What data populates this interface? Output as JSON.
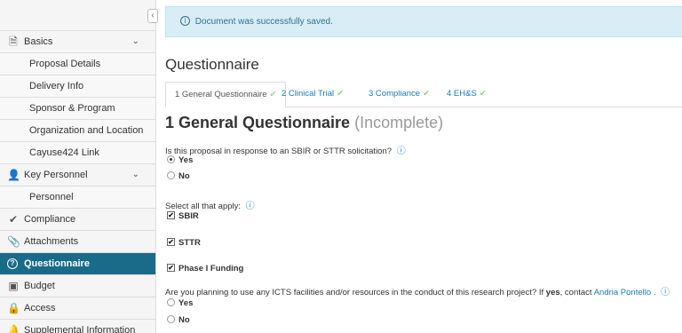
{
  "sidebar": {
    "collapse_glyph": "‹",
    "items": [
      {
        "label": "Basics",
        "icon": "document-icon",
        "glyph": "🗎",
        "chevron": "⌄"
      },
      {
        "label": "Proposal Details"
      },
      {
        "label": "Delivery Info"
      },
      {
        "label": "Sponsor & Program Information"
      },
      {
        "label": "Organization and Location"
      },
      {
        "label": "Cayuse424 Link"
      },
      {
        "label": "Key Personnel",
        "icon": "person-icon",
        "glyph": "👤",
        "chevron": "⌄"
      },
      {
        "label": "Personnel"
      },
      {
        "label": "Compliance",
        "icon": "check-icon",
        "glyph": "✔"
      },
      {
        "label": "Attachments",
        "icon": "paperclip-icon",
        "glyph": "📎"
      },
      {
        "label": "Questionnaire",
        "icon": "question-circle-icon",
        "glyph": "?"
      },
      {
        "label": "Budget",
        "icon": "money-icon",
        "glyph": "▣"
      },
      {
        "label": "Access",
        "icon": "lock-icon",
        "glyph": "🔒"
      },
      {
        "label": "Supplemental Information",
        "icon": "bell-icon",
        "glyph": "🔔"
      }
    ]
  },
  "alert": {
    "message": "Document was successfully saved.",
    "icon_glyph": "i"
  },
  "page_title": "Questionnaire",
  "tabs": [
    {
      "label": "1 General Questionnaire",
      "check": "✔"
    },
    {
      "label": "2 Clinical Trial",
      "check": "✔"
    },
    {
      "label": "3 Compliance",
      "check": "✔"
    },
    {
      "label": "4 EH&S",
      "check": "✔"
    }
  ],
  "section": {
    "title": "1 General Questionnaire",
    "status": "(Incomplete)"
  },
  "questions": {
    "q1": {
      "text": "Is this proposal in response to an SBIR or STTR solicitation?",
      "info_glyph": "ⓘ",
      "options": [
        "Yes",
        "No"
      ],
      "selected": "Yes"
    },
    "q2": {
      "text": "Select all that apply:",
      "info_glyph": "ⓘ",
      "options": [
        "SBIR",
        "STTR",
        "Phase I Funding"
      ],
      "check_glyph": "✔"
    },
    "q3": {
      "text_before": "Are you planning to use any ICTS facilities and/or resources in the conduct of this research project? If",
      "bold": "yes",
      "text_mid": ", contact",
      "link": "Andria Pontello",
      "text_after": ".",
      "info_glyph": "ⓘ",
      "options": [
        "Yes",
        "No"
      ]
    }
  }
}
